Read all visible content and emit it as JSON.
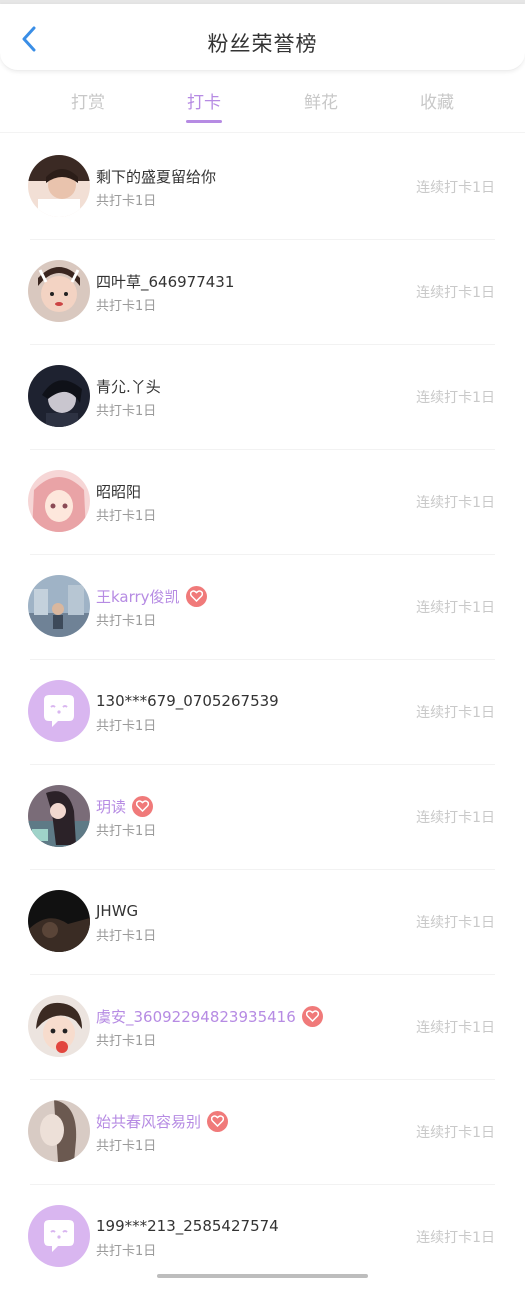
{
  "header": {
    "title": "粉丝荣誉榜",
    "back_icon": "chevron-left-icon"
  },
  "tabs": [
    {
      "label": "打赏",
      "active": false
    },
    {
      "label": "打卡",
      "active": true
    },
    {
      "label": "鲜花",
      "active": false
    },
    {
      "label": "收藏",
      "active": false
    }
  ],
  "accent_color": "#b68be3",
  "badge_color": "#f07a7a",
  "rows": [
    {
      "name": "剩下的盛夏留给你",
      "sub": "共打卡1日",
      "streak": "连续打卡1日",
      "vip": false
    },
    {
      "name": "四叶草_646977431",
      "sub": "共打卡1日",
      "streak": "连续打卡1日",
      "vip": false
    },
    {
      "name": "青尣.丫头",
      "sub": "共打卡1日",
      "streak": "连续打卡1日",
      "vip": false
    },
    {
      "name": "昭昭阳",
      "sub": "共打卡1日",
      "streak": "连续打卡1日",
      "vip": false
    },
    {
      "name": "王karry俊凯",
      "sub": "共打卡1日",
      "streak": "连续打卡1日",
      "vip": true
    },
    {
      "name": "130***679_0705267539",
      "sub": "共打卡1日",
      "streak": "连续打卡1日",
      "vip": false
    },
    {
      "name": "玥读",
      "sub": "共打卡1日",
      "streak": "连续打卡1日",
      "vip": true
    },
    {
      "name": "JHWG",
      "sub": "共打卡1日",
      "streak": "连续打卡1日",
      "vip": false
    },
    {
      "name": "虞安_36092294823935416",
      "sub": "共打卡1日",
      "streak": "连续打卡1日",
      "vip": true
    },
    {
      "name": "始共春风容易别",
      "sub": "共打卡1日",
      "streak": "连续打卡1日",
      "vip": true
    },
    {
      "name": "199***213_2585427574",
      "sub": "共打卡1日",
      "streak": "连续打卡1日",
      "vip": false
    }
  ]
}
